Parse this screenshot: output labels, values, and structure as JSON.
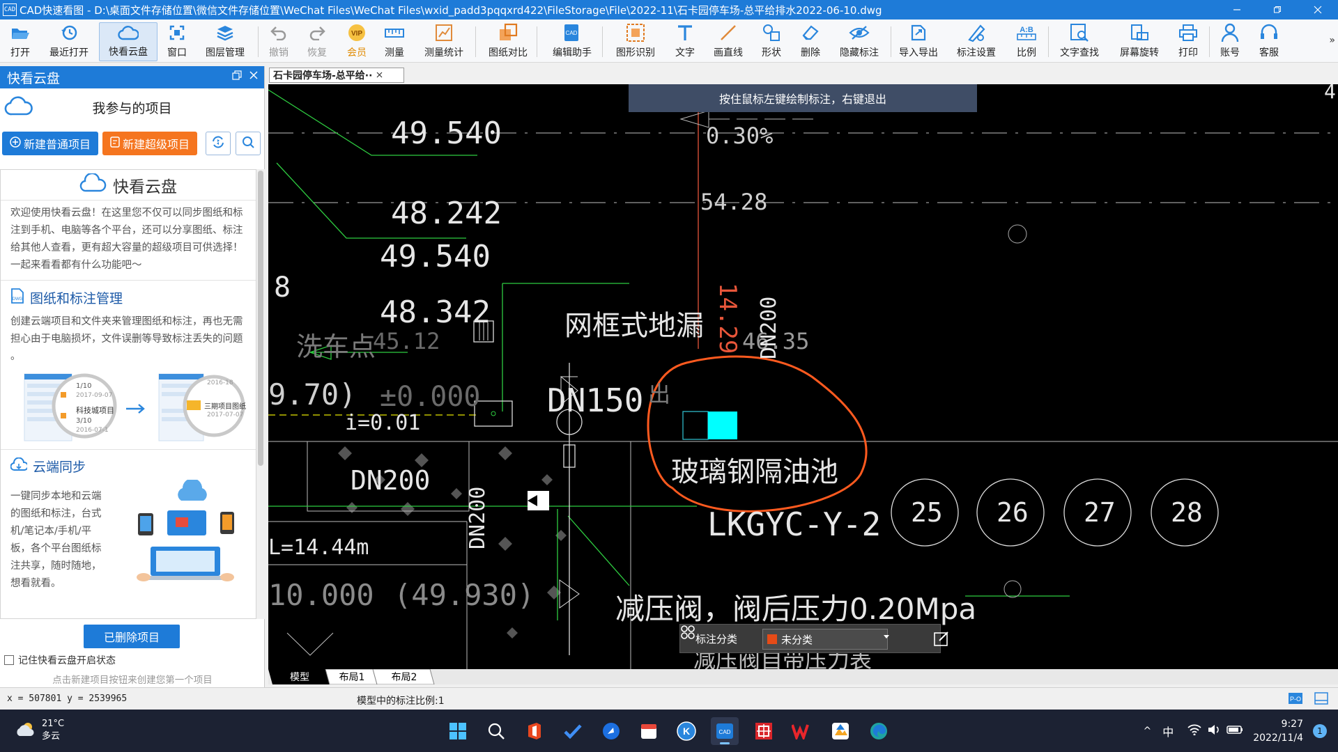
{
  "window": {
    "app_icon": "CAD",
    "title": "CAD快速看图 - D:\\桌面文件存储位置\\微信文件存储位置\\WeChat Files\\WeChat Files\\wxid_padd3pqqxrd422\\FileStorage\\File\\2022-11\\石卡园停车场-总平给排水2022-06-10.dwg"
  },
  "toolbar": {
    "items": [
      {
        "label": "打开",
        "icon": "folder-open-icon"
      },
      {
        "label": "最近打开",
        "icon": "history-icon"
      },
      {
        "label": "快看云盘",
        "icon": "cloud-icon",
        "active": true
      },
      {
        "label": "窗口",
        "icon": "window-icon"
      },
      {
        "label": "图层管理",
        "icon": "layers-icon"
      },
      {
        "label": "撤销",
        "icon": "undo-icon",
        "disabled": true
      },
      {
        "label": "恢复",
        "icon": "redo-icon",
        "disabled": true
      },
      {
        "label": "会员",
        "icon": "vip-icon",
        "vip": "VIP"
      },
      {
        "label": "测量",
        "icon": "ruler-icon"
      },
      {
        "label": "测量统计",
        "icon": "measure-stats-icon"
      },
      {
        "label": "图纸对比",
        "icon": "compare-icon"
      },
      {
        "label": "编辑助手",
        "icon": "edit-assistant-icon"
      },
      {
        "label": "图形识别",
        "icon": "shape-recognize-icon"
      },
      {
        "label": "文字",
        "icon": "text-icon"
      },
      {
        "label": "画直线",
        "icon": "line-icon"
      },
      {
        "label": "形状",
        "icon": "shape-icon"
      },
      {
        "label": "删除",
        "icon": "eraser-icon"
      },
      {
        "label": "隐藏标注",
        "icon": "hide-annotation-icon"
      },
      {
        "label": "导入导出",
        "icon": "import-export-icon"
      },
      {
        "label": "标注设置",
        "icon": "annotation-settings-icon"
      },
      {
        "label": "比例",
        "icon": "scale-icon",
        "glyph": "A:B"
      },
      {
        "label": "文字查找",
        "icon": "text-search-icon"
      },
      {
        "label": "屏幕旋转",
        "icon": "rotate-screen-icon"
      },
      {
        "label": "打印",
        "icon": "printer-icon"
      },
      {
        "label": "账号",
        "icon": "account-icon"
      },
      {
        "label": "客服",
        "icon": "headset-icon"
      }
    ],
    "more": "»"
  },
  "panel": {
    "title": "快看云盘",
    "project_title": "我参与的项目",
    "new_project": "新建普通项目",
    "new_super_project": "新建超级项目",
    "card_title": "快看云盘",
    "intro": "欢迎使用快看云盘！在这里您不仅可以同步图纸和标注到手机、电脑等各个平台，还可以分享图纸、标注给其他人查看，更有超大容量的超级项目可供选择！一起来看看都有什么功能吧～",
    "section1_title": "图纸和标注管理",
    "section1_text": "创建云端项目和文件夹来管理图纸和标注，再也无需担心由于电脑损坏，文件误删等导致标注丢失的问题 。",
    "illus1": {
      "dates": [
        "1/10",
        "2017-09-07",
        "3/10",
        "2016-07-1",
        "2016-18",
        "2017-07-07"
      ],
      "items": [
        "科技城项目",
        "三期项目图纸"
      ]
    },
    "section2_title": "云端同步",
    "section2_text": "一键同步本地和云端的图纸和标注，台式机/笔记本/手机/平板，各个平台图纸标注共享，随时随地，想看就看。",
    "deleted_btn": "已删除项目",
    "remember_label": "记住快看云盘开启状态",
    "hint": "点击新建项目按钮来创建您第一个项目"
  },
  "document": {
    "tab_label": "石卡园停车场-总平给··",
    "banner": "按住鼠标左键绘制标注，右键退出",
    "drawing_text": {
      "n1": "49.540",
      "n2": "48.242",
      "n3": "49.540",
      "n4": "48.342",
      "pct": "0.30%",
      "e1": "54.28",
      "e2": "14.29",
      "e3": "46.35",
      "e4": "45.12",
      "eight": "8",
      "dn200a": "DN200",
      "dn200b": "DN200",
      "dn200c": "DN200",
      "floor_drain": "网框式地漏",
      "dn150": "DN150",
      "outlet": "出",
      "car_wash": "洗车点",
      "p70": "9.70)",
      "pzero": "±0.000",
      "slope": "i=0.01",
      "grease_trap": "玻璃钢隔油池",
      "model_code": "LKGYC-Y-2",
      "length": "L=14.44m",
      "level1": "10.000",
      "level2": "(49.930)",
      "valve": "减压阀，阀后压力0.20Mpa",
      "valve2": "减压阀自带压力表",
      "c25": "25",
      "c26": "26",
      "c27": "27",
      "c28": "28",
      "top_right": "4 ."
    },
    "annotation_bar": {
      "label": "标注分类",
      "value": "未分类",
      "swatch_color": "#e64b17"
    },
    "layout_tabs": [
      "模型",
      "布局1",
      "布局2"
    ]
  },
  "status": {
    "coords": "x = 507801  y = 2539965",
    "scale": "模型中的标注比例:1"
  },
  "taskbar": {
    "temp": "21°C",
    "weather": "多云",
    "apps": [
      "start-icon",
      "search-icon",
      "office-icon",
      "todo-icon",
      "arrow-app-icon",
      "calendar-app-icon",
      "k-app-icon",
      "cad-app-icon",
      "red-app-icon",
      "wps-icon",
      "photo-app-icon",
      "edge-icon"
    ],
    "tray": {
      "chevron": "^",
      "ime": "中"
    },
    "time": "9:27",
    "date": "2022/11/4",
    "notifications": "1"
  }
}
